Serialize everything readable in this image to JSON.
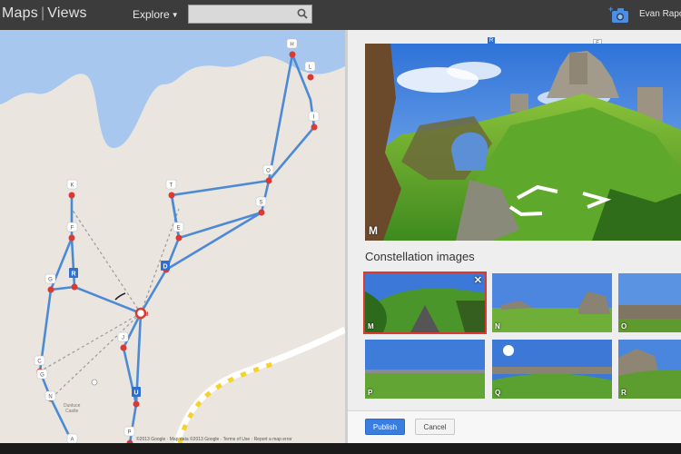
{
  "header": {
    "brand_left": "Maps",
    "brand_right": "Views",
    "explore_label": "Explore",
    "search_placeholder": "",
    "user_name": "Evan Rapop"
  },
  "icons": {
    "search": "search-icon",
    "camera": "add-photo-camera-icon",
    "caret": "caret-down-icon"
  },
  "map": {
    "place_label_line1": "Dunluce",
    "place_label_line2": "Castle",
    "attribution": "©2013 Google · Map data ©2013 Google · Terms of Use · Report a map error",
    "nodes": [
      "H",
      "L",
      "I",
      "K",
      "T",
      "O",
      "S",
      "E",
      "F",
      "B",
      "G",
      "M",
      "J",
      "C",
      "G",
      "N",
      "U",
      "P",
      "A",
      "R"
    ]
  },
  "viewer": {
    "label": "M",
    "top_marker": "F",
    "edge_marker": "R"
  },
  "constellation": {
    "title": "Constellation images",
    "images": [
      {
        "label": "M",
        "selected": true
      },
      {
        "label": "N",
        "selected": false
      },
      {
        "label": "O",
        "selected": false
      },
      {
        "label": "P",
        "selected": false
      },
      {
        "label": "Q",
        "selected": false
      },
      {
        "label": "R",
        "selected": false
      }
    ],
    "close_symbol": "✕"
  },
  "actions": {
    "publish": "Publish",
    "cancel": "Cancel"
  },
  "colors": {
    "route_blue": "#4d8ad6",
    "node_red": "#d93a31",
    "water": "#a7c7ef",
    "land": "#eae6df",
    "accent_blue": "#3a7de0"
  }
}
